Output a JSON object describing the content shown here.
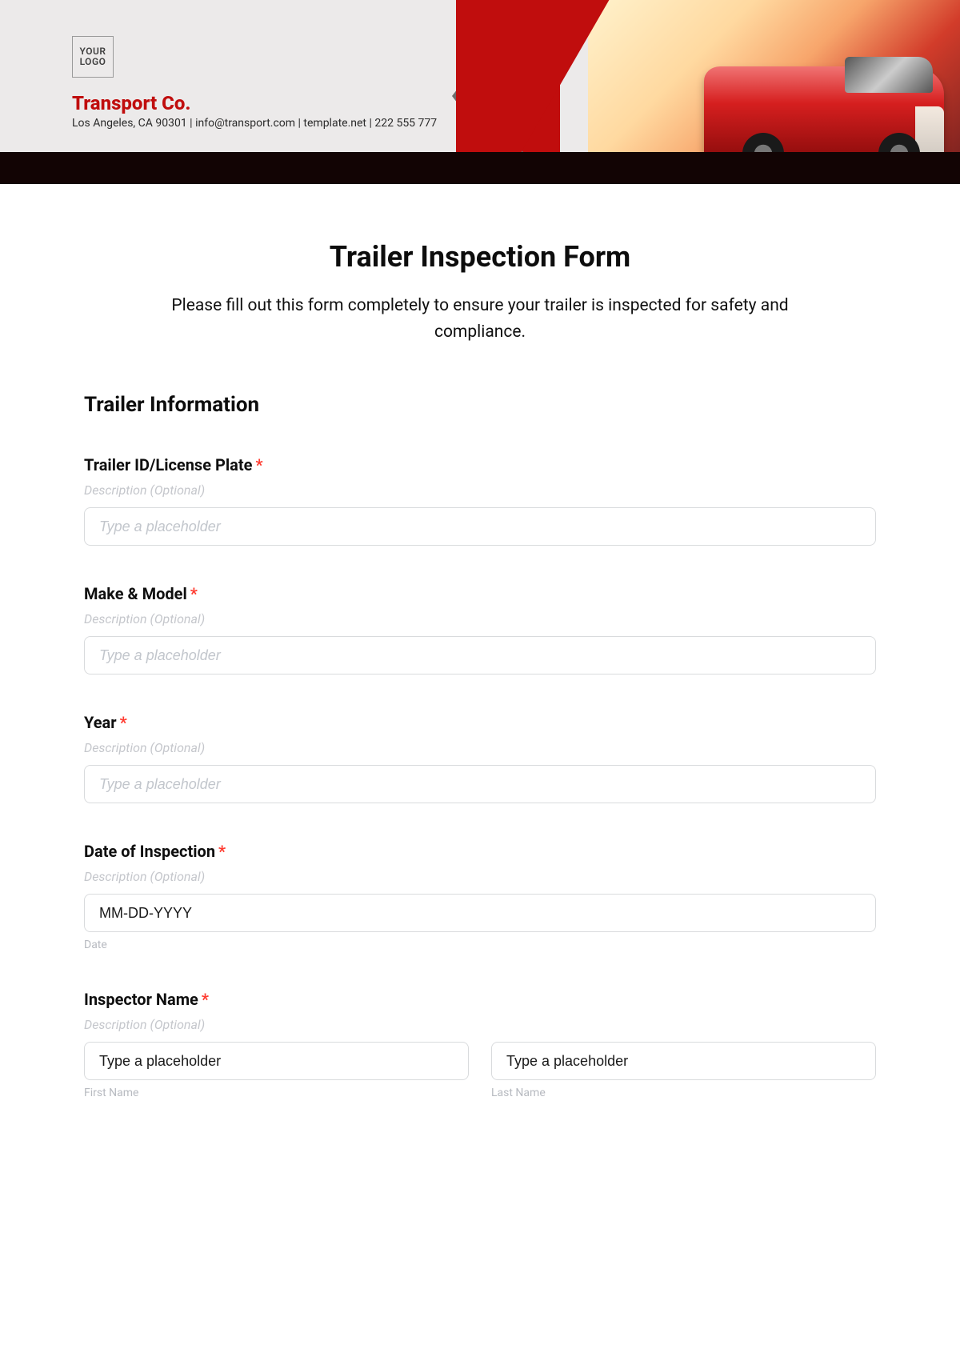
{
  "header": {
    "logo_text": "YOUR LOGO",
    "company": "Transport Co.",
    "subline": "Los Angeles, CA 90301 | info@transport.com | template.net | 222 555 777"
  },
  "form": {
    "title": "Trailer Inspection Form",
    "intro": "Please fill out this form completely to ensure your trailer is inspected for safety and compliance.",
    "section_title": "Trailer Information",
    "required_mark": "*",
    "desc_placeholder": "Description (Optional)",
    "fields": {
      "trailer_id": {
        "label": "Trailer ID/License Plate",
        "placeholder": "Type a placeholder"
      },
      "make_model": {
        "label": "Make & Model",
        "placeholder": "Type a placeholder"
      },
      "year": {
        "label": "Year",
        "placeholder": "Type a placeholder"
      },
      "date": {
        "label": "Date of Inspection",
        "placeholder": "MM-DD-YYYY",
        "sublabel": "Date"
      },
      "inspector": {
        "label": "Inspector Name",
        "first_placeholder": "Type a placeholder",
        "last_placeholder": "Type a placeholder",
        "first_sub": "First Name",
        "last_sub": "Last Name"
      }
    }
  }
}
